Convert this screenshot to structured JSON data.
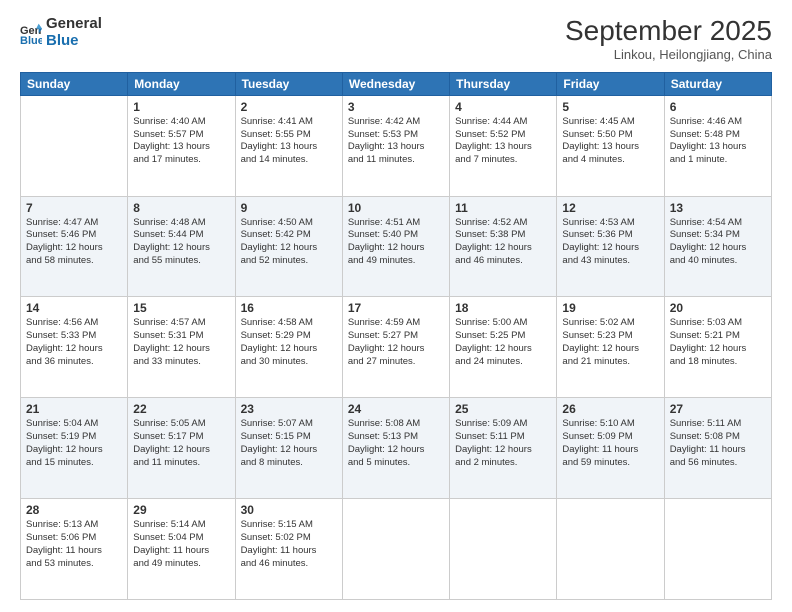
{
  "header": {
    "logo_line1": "General",
    "logo_line2": "Blue",
    "month": "September 2025",
    "location": "Linkou, Heilongjiang, China"
  },
  "weekdays": [
    "Sunday",
    "Monday",
    "Tuesday",
    "Wednesday",
    "Thursday",
    "Friday",
    "Saturday"
  ],
  "weeks": [
    [
      {
        "day": "",
        "info": ""
      },
      {
        "day": "1",
        "info": "Sunrise: 4:40 AM\nSunset: 5:57 PM\nDaylight: 13 hours\nand 17 minutes."
      },
      {
        "day": "2",
        "info": "Sunrise: 4:41 AM\nSunset: 5:55 PM\nDaylight: 13 hours\nand 14 minutes."
      },
      {
        "day": "3",
        "info": "Sunrise: 4:42 AM\nSunset: 5:53 PM\nDaylight: 13 hours\nand 11 minutes."
      },
      {
        "day": "4",
        "info": "Sunrise: 4:44 AM\nSunset: 5:52 PM\nDaylight: 13 hours\nand 7 minutes."
      },
      {
        "day": "5",
        "info": "Sunrise: 4:45 AM\nSunset: 5:50 PM\nDaylight: 13 hours\nand 4 minutes."
      },
      {
        "day": "6",
        "info": "Sunrise: 4:46 AM\nSunset: 5:48 PM\nDaylight: 13 hours\nand 1 minute."
      }
    ],
    [
      {
        "day": "7",
        "info": "Sunrise: 4:47 AM\nSunset: 5:46 PM\nDaylight: 12 hours\nand 58 minutes."
      },
      {
        "day": "8",
        "info": "Sunrise: 4:48 AM\nSunset: 5:44 PM\nDaylight: 12 hours\nand 55 minutes."
      },
      {
        "day": "9",
        "info": "Sunrise: 4:50 AM\nSunset: 5:42 PM\nDaylight: 12 hours\nand 52 minutes."
      },
      {
        "day": "10",
        "info": "Sunrise: 4:51 AM\nSunset: 5:40 PM\nDaylight: 12 hours\nand 49 minutes."
      },
      {
        "day": "11",
        "info": "Sunrise: 4:52 AM\nSunset: 5:38 PM\nDaylight: 12 hours\nand 46 minutes."
      },
      {
        "day": "12",
        "info": "Sunrise: 4:53 AM\nSunset: 5:36 PM\nDaylight: 12 hours\nand 43 minutes."
      },
      {
        "day": "13",
        "info": "Sunrise: 4:54 AM\nSunset: 5:34 PM\nDaylight: 12 hours\nand 40 minutes."
      }
    ],
    [
      {
        "day": "14",
        "info": "Sunrise: 4:56 AM\nSunset: 5:33 PM\nDaylight: 12 hours\nand 36 minutes."
      },
      {
        "day": "15",
        "info": "Sunrise: 4:57 AM\nSunset: 5:31 PM\nDaylight: 12 hours\nand 33 minutes."
      },
      {
        "day": "16",
        "info": "Sunrise: 4:58 AM\nSunset: 5:29 PM\nDaylight: 12 hours\nand 30 minutes."
      },
      {
        "day": "17",
        "info": "Sunrise: 4:59 AM\nSunset: 5:27 PM\nDaylight: 12 hours\nand 27 minutes."
      },
      {
        "day": "18",
        "info": "Sunrise: 5:00 AM\nSunset: 5:25 PM\nDaylight: 12 hours\nand 24 minutes."
      },
      {
        "day": "19",
        "info": "Sunrise: 5:02 AM\nSunset: 5:23 PM\nDaylight: 12 hours\nand 21 minutes."
      },
      {
        "day": "20",
        "info": "Sunrise: 5:03 AM\nSunset: 5:21 PM\nDaylight: 12 hours\nand 18 minutes."
      }
    ],
    [
      {
        "day": "21",
        "info": "Sunrise: 5:04 AM\nSunset: 5:19 PM\nDaylight: 12 hours\nand 15 minutes."
      },
      {
        "day": "22",
        "info": "Sunrise: 5:05 AM\nSunset: 5:17 PM\nDaylight: 12 hours\nand 11 minutes."
      },
      {
        "day": "23",
        "info": "Sunrise: 5:07 AM\nSunset: 5:15 PM\nDaylight: 12 hours\nand 8 minutes."
      },
      {
        "day": "24",
        "info": "Sunrise: 5:08 AM\nSunset: 5:13 PM\nDaylight: 12 hours\nand 5 minutes."
      },
      {
        "day": "25",
        "info": "Sunrise: 5:09 AM\nSunset: 5:11 PM\nDaylight: 12 hours\nand 2 minutes."
      },
      {
        "day": "26",
        "info": "Sunrise: 5:10 AM\nSunset: 5:09 PM\nDaylight: 11 hours\nand 59 minutes."
      },
      {
        "day": "27",
        "info": "Sunrise: 5:11 AM\nSunset: 5:08 PM\nDaylight: 11 hours\nand 56 minutes."
      }
    ],
    [
      {
        "day": "28",
        "info": "Sunrise: 5:13 AM\nSunset: 5:06 PM\nDaylight: 11 hours\nand 53 minutes."
      },
      {
        "day": "29",
        "info": "Sunrise: 5:14 AM\nSunset: 5:04 PM\nDaylight: 11 hours\nand 49 minutes."
      },
      {
        "day": "30",
        "info": "Sunrise: 5:15 AM\nSunset: 5:02 PM\nDaylight: 11 hours\nand 46 minutes."
      },
      {
        "day": "",
        "info": ""
      },
      {
        "day": "",
        "info": ""
      },
      {
        "day": "",
        "info": ""
      },
      {
        "day": "",
        "info": ""
      }
    ]
  ]
}
